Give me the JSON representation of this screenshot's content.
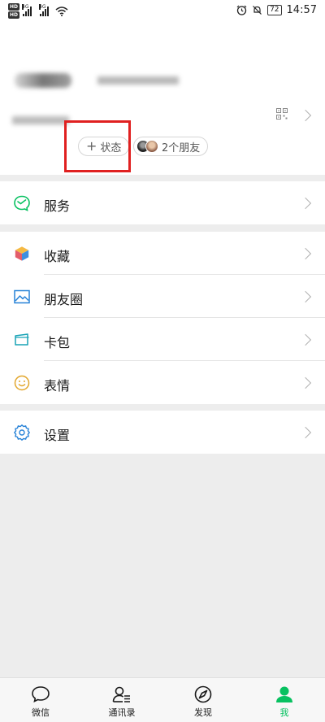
{
  "status_bar": {
    "hd1": "HD",
    "hd2": "HD",
    "net1": "4G",
    "net2": "4G",
    "battery": "72",
    "time": "14:57"
  },
  "profile": {
    "status_button": "状态",
    "friends_button": "2个朋友"
  },
  "menu": {
    "services": "服务",
    "favorites": "收藏",
    "moments": "朋友圈",
    "cards": "卡包",
    "stickers": "表情",
    "settings": "设置"
  },
  "tabs": [
    {
      "label": "微信"
    },
    {
      "label": "通讯录"
    },
    {
      "label": "发现"
    },
    {
      "label": "我"
    }
  ],
  "colors": {
    "accent": "#07c160",
    "highlight": "#e02020"
  }
}
